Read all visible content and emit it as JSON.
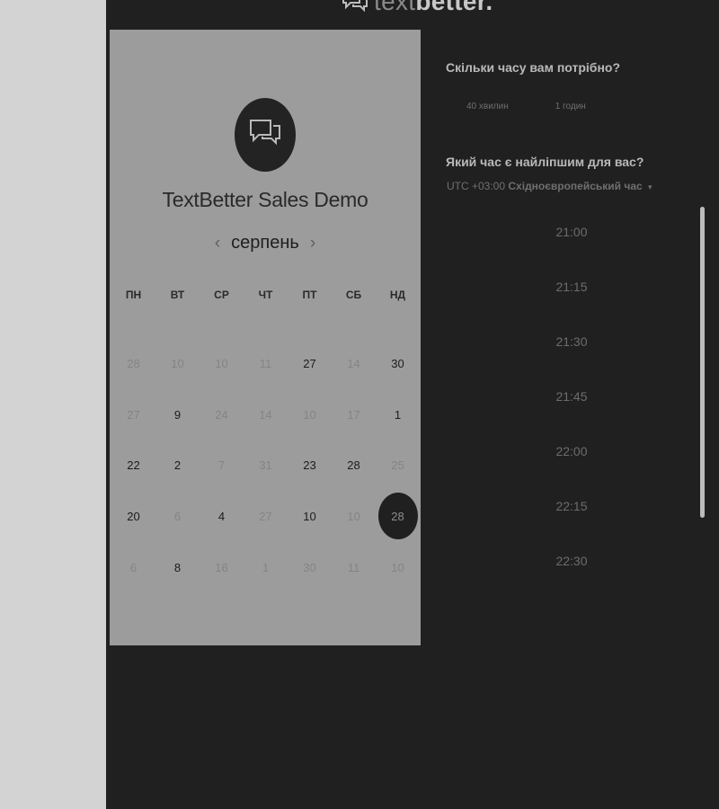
{
  "brand": {
    "logo_light": "text",
    "logo_bold": "better."
  },
  "calendar": {
    "title": "TextBetter Sales Demo",
    "month": "серпень",
    "prev_arrow": "‹",
    "next_arrow": "›",
    "weekdays": [
      "ПН",
      "ВТ",
      "СР",
      "ЧТ",
      "ПТ",
      "СБ",
      "НД"
    ],
    "days": [
      [
        "28",
        "10",
        "10",
        "11",
        "27",
        "14",
        "30"
      ],
      [
        "27",
        "9",
        "24",
        "14",
        "10",
        "17",
        "1"
      ],
      [
        "22",
        "2",
        "7",
        "31",
        "23",
        "28",
        "25"
      ],
      [
        "20",
        "6",
        "4",
        "27",
        "10",
        "10",
        "28"
      ],
      [
        "6",
        "8",
        "16",
        "1",
        "30",
        "11",
        "10"
      ]
    ],
    "available_days": [
      [
        false,
        false,
        false,
        false,
        true,
        false,
        true
      ],
      [
        false,
        true,
        false,
        false,
        false,
        false,
        true
      ],
      [
        true,
        true,
        false,
        false,
        true,
        true,
        false
      ],
      [
        true,
        false,
        true,
        false,
        true,
        false,
        false
      ],
      [
        false,
        true,
        false,
        false,
        false,
        false,
        false
      ]
    ],
    "selected_day": {
      "row": 3,
      "col": 6
    }
  },
  "scheduling": {
    "duration_question": "Скільки часу вам потрібно?",
    "durations": [
      "40 хвилин",
      "1 годин"
    ],
    "time_question": "Який час є найліпшим для вас?",
    "timezone_offset": "UTC +03:00",
    "timezone_name": "Східноєвропейський час",
    "timezone_caret": "▾",
    "slots": [
      "21:00",
      "21:15",
      "21:30",
      "21:45",
      "22:00",
      "22:15",
      "22:30"
    ]
  },
  "colors": {
    "page_bg": "#202020",
    "card_bg": "#9c9c9c",
    "sidebar_bg": "#d3d3d3",
    "selected_day_bg": "#202020"
  }
}
